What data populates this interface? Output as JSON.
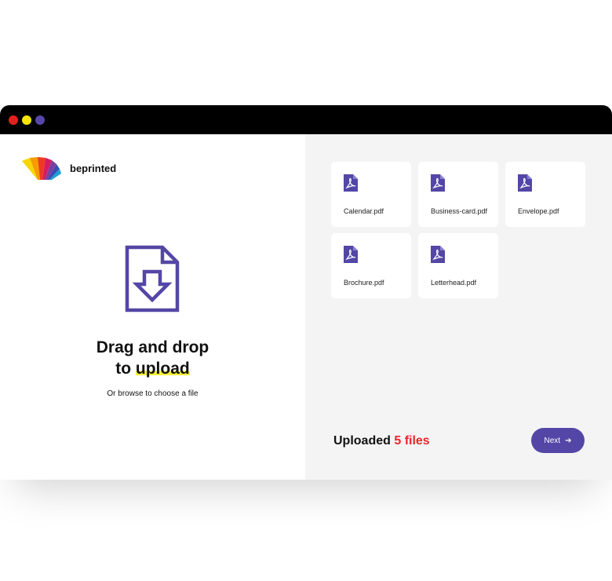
{
  "brand": {
    "name": "beprinted"
  },
  "dropzone": {
    "title_line1": "Drag and drop",
    "title_to": "to ",
    "title_highlight": "upload",
    "browse_text": "Or browse to choose a file"
  },
  "files": [
    {
      "name": "Calendar.pdf",
      "icon": "pdf-icon"
    },
    {
      "name": "Business-card.pdf",
      "icon": "pdf-icon"
    },
    {
      "name": "Envelope.pdf",
      "icon": "pdf-icon"
    },
    {
      "name": "Brochure.pdf",
      "icon": "pdf-icon"
    },
    {
      "name": "Letterhead.pdf",
      "icon": "pdf-icon"
    }
  ],
  "status": {
    "prefix": "Uploaded ",
    "count": "5 files"
  },
  "actions": {
    "next_label": "Next"
  },
  "colors": {
    "accent": "#5446a6",
    "count_red": "#e8262a",
    "highlight_yellow": "#f5ef3a",
    "dot_red": "#e2211c",
    "dot_yellow": "#f7e600",
    "dot_purple": "#5847a8"
  }
}
